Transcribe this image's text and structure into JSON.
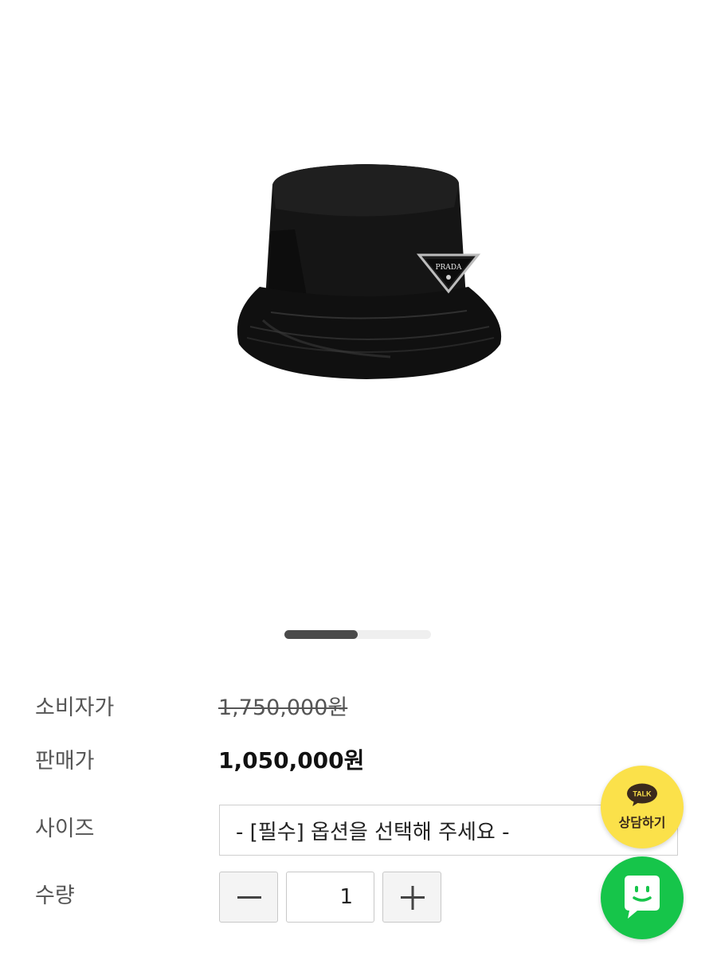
{
  "gallery": {
    "image_icon": "prada-bucket-hat-image",
    "logo_text": "PRADA",
    "slide_progress": 0.5
  },
  "details": {
    "retail_price_label": "소비자가",
    "retail_price": "1,750,000원",
    "sale_price_label": "판매가",
    "sale_price": "1,050,000원",
    "size_label": "사이즈",
    "size_placeholder": "- [필수] 옵션을 선택해 주세요 -",
    "quantity_label": "수량",
    "quantity_value": "1"
  },
  "floating": {
    "kakao_talk_badge": "TALK",
    "kakao_consult_label": "상담하기",
    "kakao_color": "#FBE14A",
    "naver_talk_icon": "chat-bubble-icon",
    "naver_color": "#16C54A"
  },
  "icons": {
    "minus": "minus-icon",
    "plus": "plus-icon"
  }
}
